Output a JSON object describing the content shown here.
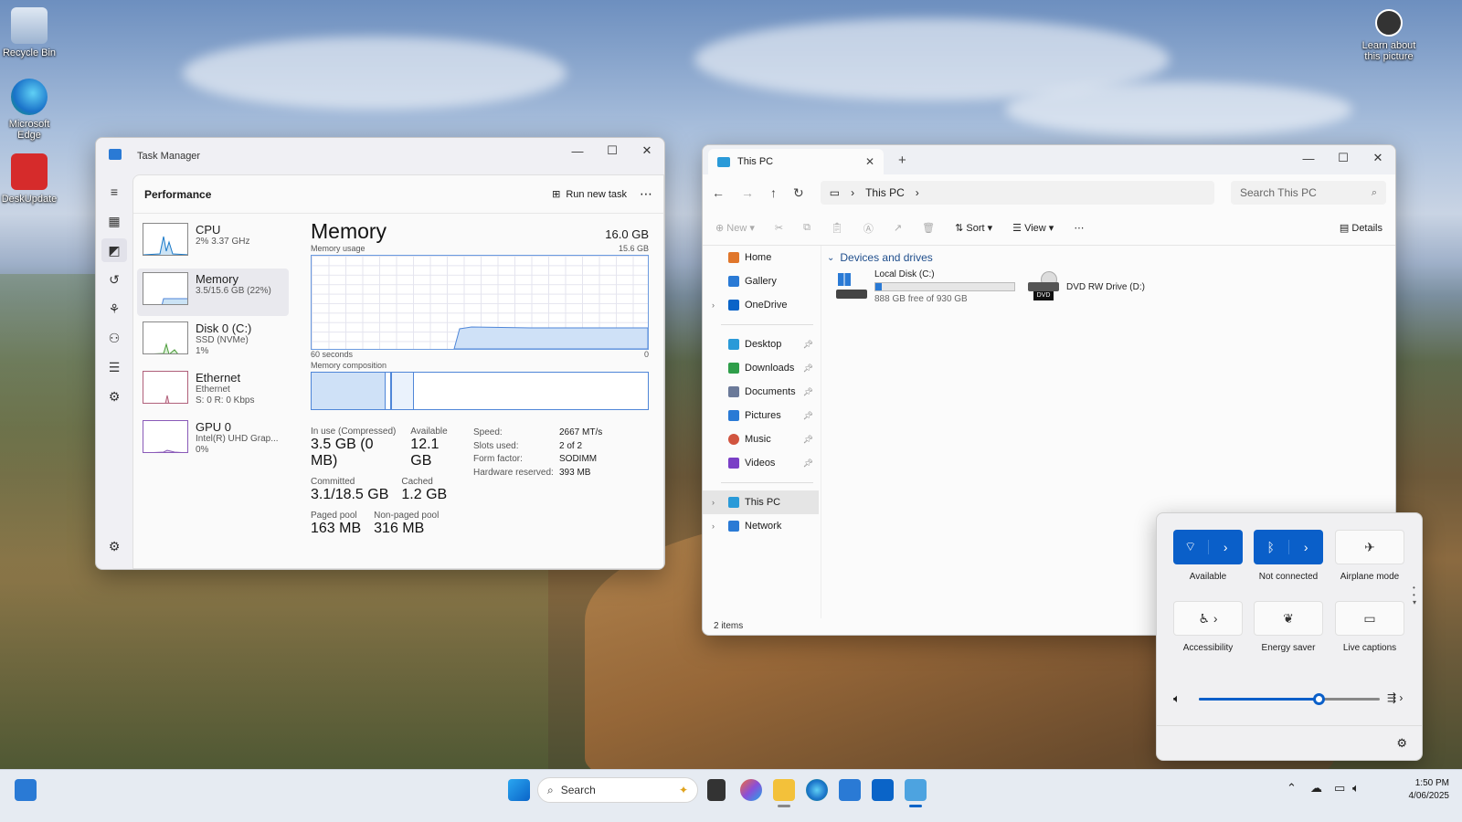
{
  "desktop": {
    "icons": [
      {
        "label": "Recycle Bin"
      },
      {
        "label": "Microsoft Edge"
      },
      {
        "label": "DeskUpdate"
      }
    ],
    "learn": "Learn about this picture"
  },
  "taskmgr": {
    "title": "Task Manager",
    "header": "Performance",
    "run_task": "Run new task",
    "perf_items": [
      {
        "name": "CPU",
        "sub1": "2% 3.37 GHz",
        "sub2": ""
      },
      {
        "name": "Memory",
        "sub1": "3.5/15.6 GB (22%)",
        "sub2": ""
      },
      {
        "name": "Disk 0 (C:)",
        "sub1": "SSD (NVMe)",
        "sub2": "1%"
      },
      {
        "name": "Ethernet",
        "sub1": "Ethernet",
        "sub2": "S: 0 R: 0 Kbps"
      },
      {
        "name": "GPU 0",
        "sub1": "Intel(R) UHD Grap...",
        "sub2": "0%"
      }
    ],
    "memory": {
      "title": "Memory",
      "capacity": "16.0 GB",
      "usage_label": "Memory usage",
      "usage_max": "15.6 GB",
      "time_left": "60 seconds",
      "time_right": "0",
      "composition_label": "Memory composition",
      "in_use_label": "In use (Compressed)",
      "in_use": "3.5 GB (0 MB)",
      "available_label": "Available",
      "available": "12.1 GB",
      "committed_label": "Committed",
      "committed": "3.1/18.5 GB",
      "cached_label": "Cached",
      "cached": "1.2 GB",
      "paged_label": "Paged pool",
      "paged": "163 MB",
      "nonpaged_label": "Non-paged pool",
      "nonpaged": "316 MB",
      "speed_label": "Speed:",
      "speed": "2667 MT/s",
      "slots_label": "Slots used:",
      "slots": "2 of 2",
      "form_label": "Form factor:",
      "form": "SODIMM",
      "reserved_label": "Hardware reserved:",
      "reserved": "393 MB",
      "in_use_fraction": 0.22
    }
  },
  "explorer": {
    "tab_title": "This PC",
    "breadcrumb": "This PC",
    "search_placeholder": "Search This PC",
    "cmd": {
      "new": "New",
      "sort": "Sort",
      "view": "View",
      "details": "Details"
    },
    "nav": [
      {
        "label": "Home",
        "color": "#e0762b"
      },
      {
        "label": "Gallery",
        "color": "#2a7ad5"
      },
      {
        "label": "OneDrive",
        "color": "#0a64c8"
      },
      {
        "label": "Desktop",
        "color": "#2a9ad8"
      },
      {
        "label": "Downloads",
        "color": "#2f9e4a"
      },
      {
        "label": "Documents",
        "color": "#6b7a99"
      },
      {
        "label": "Pictures",
        "color": "#2a7ad5"
      },
      {
        "label": "Music",
        "color": "#d1543f"
      },
      {
        "label": "Videos",
        "color": "#7a3fc6"
      },
      {
        "label": "This PC",
        "color": "#2a9ad8"
      },
      {
        "label": "Network",
        "color": "#2a7ad5"
      }
    ],
    "section": "Devices and drives",
    "drives": [
      {
        "name": "Local Disk (C:)",
        "free": "888 GB free of 930 GB",
        "used_fraction": 0.045
      },
      {
        "name": "DVD RW Drive (D:)",
        "badge": "DVD"
      }
    ],
    "status": "2 items"
  },
  "quick": {
    "tiles": [
      {
        "label": "Available"
      },
      {
        "label": "Not connected"
      },
      {
        "label": "Airplane mode"
      },
      {
        "label": "Accessibility"
      },
      {
        "label": "Energy saver"
      },
      {
        "label": "Live captions"
      }
    ],
    "volume_fraction": 0.66
  },
  "taskbar": {
    "search": "Search",
    "time": "1:50 PM",
    "date": "4/06/2025"
  },
  "colors": {
    "accent": "#0a5fc9",
    "memory_line": "#4f86d8"
  }
}
